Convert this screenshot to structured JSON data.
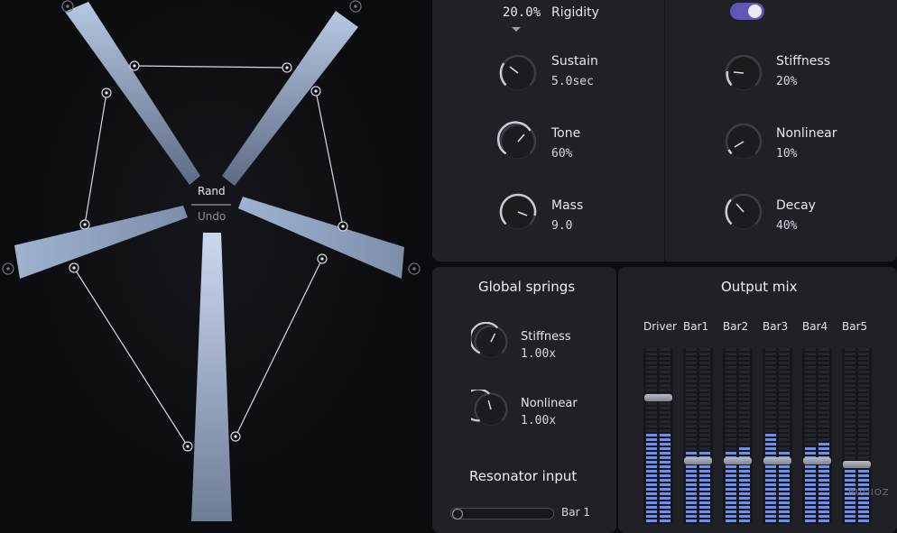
{
  "left": {
    "rand_label": "Rand",
    "undo_label": "Undo"
  },
  "top_left": {
    "rigidity_value": "20.0%",
    "rigidity_label": "Rigidity",
    "sustain_label": "Sustain",
    "sustain_value": "5.0sec",
    "tone_label": "Tone",
    "tone_value": "60%",
    "mass_label": "Mass",
    "mass_value": "9.0"
  },
  "top_right": {
    "toggle_on": true,
    "stiffness_label": "Stiffness",
    "stiffness_value": "20%",
    "nonlinear_label": "Nonlinear",
    "nonlinear_value": "10%",
    "decay_label": "Decay",
    "decay_value": "40%"
  },
  "global_springs": {
    "title": "Global springs",
    "stiffness_label": "Stiffness",
    "stiffness_value": "1.00x",
    "nonlinear_label": "Nonlinear",
    "nonlinear_value": "1.00x"
  },
  "resonator_input": {
    "title": "Resonator input",
    "selected": "Bar 1"
  },
  "output_mix": {
    "title": "Output mix",
    "channels": [
      {
        "name": "Driver",
        "fader": 0.72,
        "level_l": 0.52,
        "level_r": 0.52
      },
      {
        "name": "Bar1",
        "fader": 0.36,
        "level_l": 0.4,
        "level_r": 0.4
      },
      {
        "name": "Bar2",
        "fader": 0.36,
        "level_l": 0.4,
        "level_r": 0.44
      },
      {
        "name": "Bar3",
        "fader": 0.36,
        "level_l": 0.52,
        "level_r": 0.4
      },
      {
        "name": "Bar4",
        "fader": 0.36,
        "level_l": 0.44,
        "level_r": 0.47
      },
      {
        "name": "Bar5",
        "fader": 0.34,
        "level_l": 0.32,
        "level_r": 0.32
      }
    ]
  },
  "colors": {
    "accent": "#5f7fe0",
    "meter_on": "#6f8ff0",
    "meter_off": "#23262c",
    "toggle": "#5e56b8"
  }
}
